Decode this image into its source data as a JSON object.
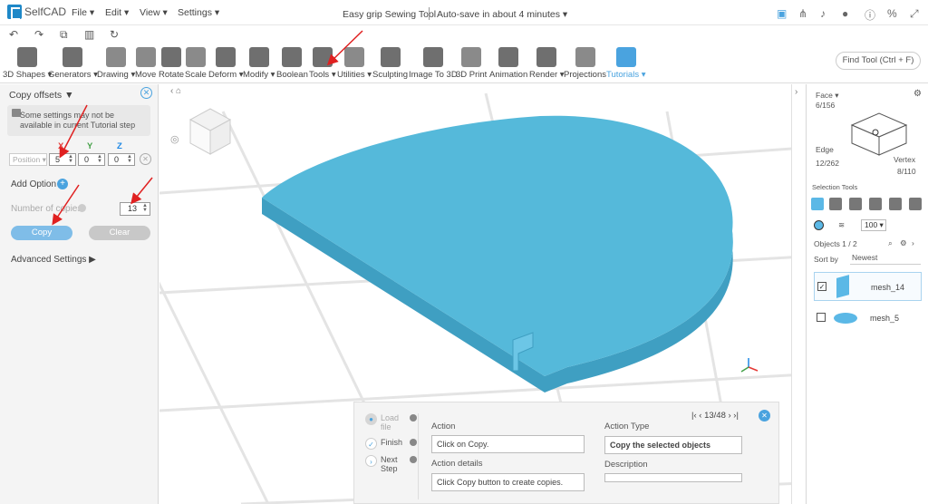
{
  "app": {
    "name": "SelfCAD",
    "title": "Easy grip Sewing Tool",
    "autosave": "Auto-save in about 4 minutes"
  },
  "menu": [
    "File",
    "Edit",
    "View",
    "Settings"
  ],
  "toolbar": [
    {
      "label": "3D Shapes"
    },
    {
      "label": "Generators"
    },
    {
      "label": "Drawing"
    },
    {
      "label": "Move"
    },
    {
      "label": "Rotate"
    },
    {
      "label": "Scale"
    },
    {
      "label": "Deform"
    },
    {
      "label": "Modify"
    },
    {
      "label": "Boolean"
    },
    {
      "label": "Tools"
    },
    {
      "label": "Utilities"
    },
    {
      "label": "Sculpting"
    },
    {
      "label": "Image To 3D"
    },
    {
      "label": "3D Print"
    },
    {
      "label": "Animation"
    },
    {
      "label": "Render"
    },
    {
      "label": "Projections"
    },
    {
      "label": "Tutorials"
    }
  ],
  "find_tool": "Find Tool (Ctrl + F)",
  "left_panel": {
    "title": "Copy offsets",
    "warning": "Some settings may not be available in current Tutorial step",
    "axis": [
      "X",
      "Y",
      "Z"
    ],
    "position_select": "Position",
    "offsets": [
      "5",
      "0",
      "0"
    ],
    "add_option": "Add Option",
    "copies_label": "Number of copies",
    "copies_value": "13",
    "copy_button": "Copy",
    "clear_button": "Clear",
    "advanced": "Advanced Settings"
  },
  "action_panel": {
    "steps": [
      "Load file",
      "Finish",
      "Next Step"
    ],
    "action_label": "Action",
    "action_value": "Click on Copy.",
    "action_details_label": "Action details",
    "action_details_value": "Click Copy button to create copies.",
    "action_type_label": "Action Type",
    "action_type_value": "Copy the selected objects",
    "description_label": "Description",
    "pager": "13/48"
  },
  "right_panel": {
    "face_label": "Face",
    "face_count": "6/156",
    "edge_label": "Edge",
    "edge_count": "12/262",
    "vertex_label": "Vertex",
    "vertex_count": "8/110",
    "selection_tools": "Selection Tools",
    "zoom_value": "100",
    "objects_label": "Objects 1 / 2",
    "sort_label": "Sort by",
    "sort_value": "Newest",
    "objects": [
      {
        "name": "mesh_14",
        "checked": true
      },
      {
        "name": "mesh_5",
        "checked": false
      }
    ]
  },
  "colors": {
    "accent": "#4aa3df",
    "mesh": "#55b9da",
    "mesh_side": "#3f9fc2",
    "annotation": "#e02020"
  }
}
